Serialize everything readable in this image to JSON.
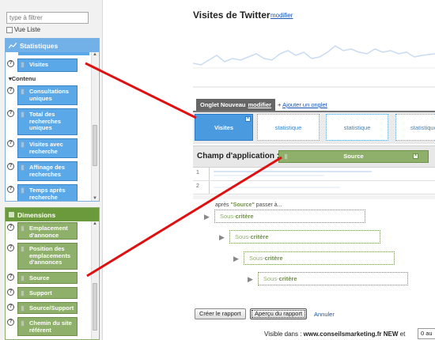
{
  "left_panel": {
    "filter_placeholder": "type à filtrer",
    "vue_liste_label": "Vue Liste",
    "statistiques": {
      "header": "Statistiques",
      "first_item": "Visites",
      "section_label": "Contenu",
      "items": [
        "Consultations uniques",
        "Total des recherches uniques",
        "Visites avec recherche",
        "Affinage des recherches",
        "Temps après recherche"
      ]
    },
    "dimensions": {
      "header": "Dimensions",
      "items": [
        "Emplacement d'annonce",
        "Position des emplacements d'annonces",
        "Source",
        "Support",
        "Source/Support",
        "Chemin du site référent"
      ]
    }
  },
  "main": {
    "title": "Visites de Twitter",
    "modifier_link": "modifier",
    "tab_header": "Onglet Nouveau",
    "tab_header_modifier": "modifier",
    "add_tab_prefix": "+",
    "add_tab_link": "Ajouter un onglet",
    "tabs": [
      "Visites",
      "statistique",
      "statistique",
      "statistique"
    ],
    "scope_label": "Champ d'application :",
    "scope_value": "Source",
    "table_rows": [
      "1",
      "2"
    ],
    "apres_prefix": "après",
    "apres_source": "\"Source\"",
    "apres_suffix": "passer à...",
    "sub_prefix": "Sous-",
    "sub_suffix": "critère",
    "buttons": {
      "create": "Créer le rapport",
      "preview": "Aperçu du rapport",
      "cancel": "Annuler"
    },
    "visible_in_prefix": "Visible dans :",
    "visible_in_site": "www.conseilsmarketing.fr NEW",
    "visible_in_suffix": "et",
    "visible_in_select": "0 au"
  },
  "colors": {
    "blue_item": "#5aa8e8",
    "green_item": "#8fb06a",
    "annotation_red": "#e01010"
  }
}
